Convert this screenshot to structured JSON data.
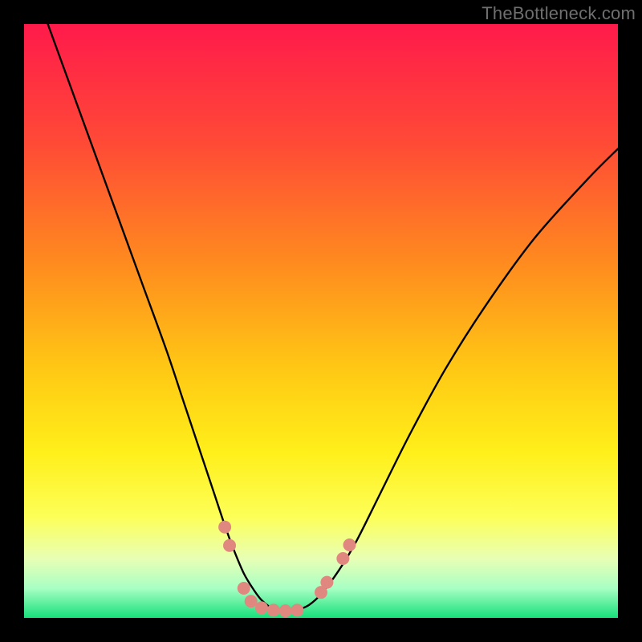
{
  "watermark": "TheBottleneck.com",
  "chart_data": {
    "type": "line",
    "title": "",
    "xlabel": "",
    "ylabel": "",
    "xlim": [
      0,
      100
    ],
    "ylim": [
      0,
      100
    ],
    "grid": false,
    "legend": false,
    "gradient_stops": [
      {
        "offset": 0.0,
        "color": "#ff1a4b"
      },
      {
        "offset": 0.2,
        "color": "#ff4a36"
      },
      {
        "offset": 0.4,
        "color": "#ff8a1f"
      },
      {
        "offset": 0.58,
        "color": "#ffc814"
      },
      {
        "offset": 0.72,
        "color": "#ffef1a"
      },
      {
        "offset": 0.83,
        "color": "#fdff58"
      },
      {
        "offset": 0.9,
        "color": "#e8ffb4"
      },
      {
        "offset": 0.95,
        "color": "#a8ffc4"
      },
      {
        "offset": 1.0,
        "color": "#16e07a"
      }
    ],
    "series": [
      {
        "name": "curve",
        "color": "#000000",
        "x": [
          4,
          8,
          12,
          16,
          20,
          24,
          27,
          30,
          32,
          34,
          35.5,
          37,
          38.5,
          40,
          42,
          44,
          46,
          48,
          50,
          53,
          56,
          60,
          65,
          71,
          78,
          86,
          95,
          100
        ],
        "y": [
          100,
          89,
          78,
          67,
          56,
          45,
          36,
          27,
          21,
          15,
          11,
          7.5,
          5,
          3,
          1.5,
          1,
          1.3,
          2.2,
          4,
          8,
          13,
          21,
          31,
          42,
          53,
          64,
          74,
          79
        ]
      }
    ],
    "markers": {
      "color": "#e0877f",
      "radius_px": 8,
      "points": [
        {
          "x": 33.8,
          "y": 15.3
        },
        {
          "x": 34.6,
          "y": 12.2
        },
        {
          "x": 37.0,
          "y": 5.0
        },
        {
          "x": 38.2,
          "y": 2.8
        },
        {
          "x": 40.0,
          "y": 1.7
        },
        {
          "x": 42.0,
          "y": 1.3
        },
        {
          "x": 44.0,
          "y": 1.2
        },
        {
          "x": 46.0,
          "y": 1.3
        },
        {
          "x": 50.0,
          "y": 4.3
        },
        {
          "x": 51.0,
          "y": 6.0
        },
        {
          "x": 53.7,
          "y": 10.0
        },
        {
          "x": 54.8,
          "y": 12.3
        }
      ]
    }
  }
}
